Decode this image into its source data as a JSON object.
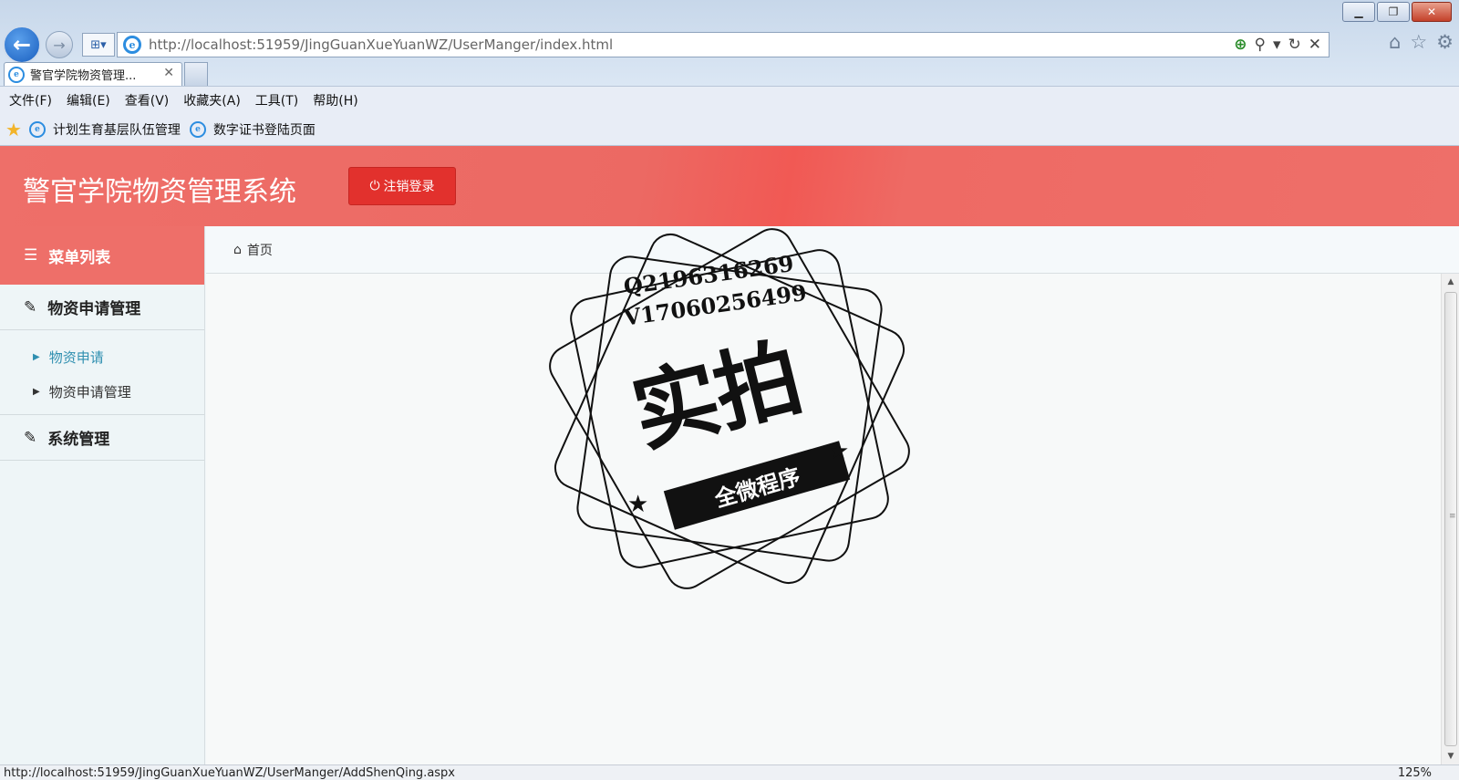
{
  "browser": {
    "url": "http://localhost:51959/JingGuanXueYuanWZ/UserManger/index.html",
    "tab_title": "警官学院物资管理...",
    "menu": [
      "文件(F)",
      "编辑(E)",
      "查看(V)",
      "收藏夹(A)",
      "工具(T)",
      "帮助(H)"
    ],
    "favorites": [
      "计划生育基层队伍管理",
      "数字证书登陆页面"
    ],
    "status_url": "http://localhost:51959/JingGuanXueYuanWZ/UserManger/AddShenQing.aspx",
    "zoom": "125%"
  },
  "header": {
    "title": "警官学院物资管理系统",
    "logout_label": "注销登录"
  },
  "sidebar": {
    "heading": "菜单列表",
    "groups": [
      {
        "label": "物资申请管理",
        "items": [
          "物资申请",
          "物资申请管理"
        ]
      },
      {
        "label": "系统管理"
      }
    ]
  },
  "breadcrumb": {
    "home": "首页"
  },
  "watermark": {
    "line1": "Q2196316269",
    "line2": "V17060256499",
    "main": "实拍",
    "ribbon": "全微程序"
  },
  "colors": {
    "header_bg": "#ee6f69",
    "logout_btn": "#e2312d",
    "active_link": "#2f8fb0"
  }
}
